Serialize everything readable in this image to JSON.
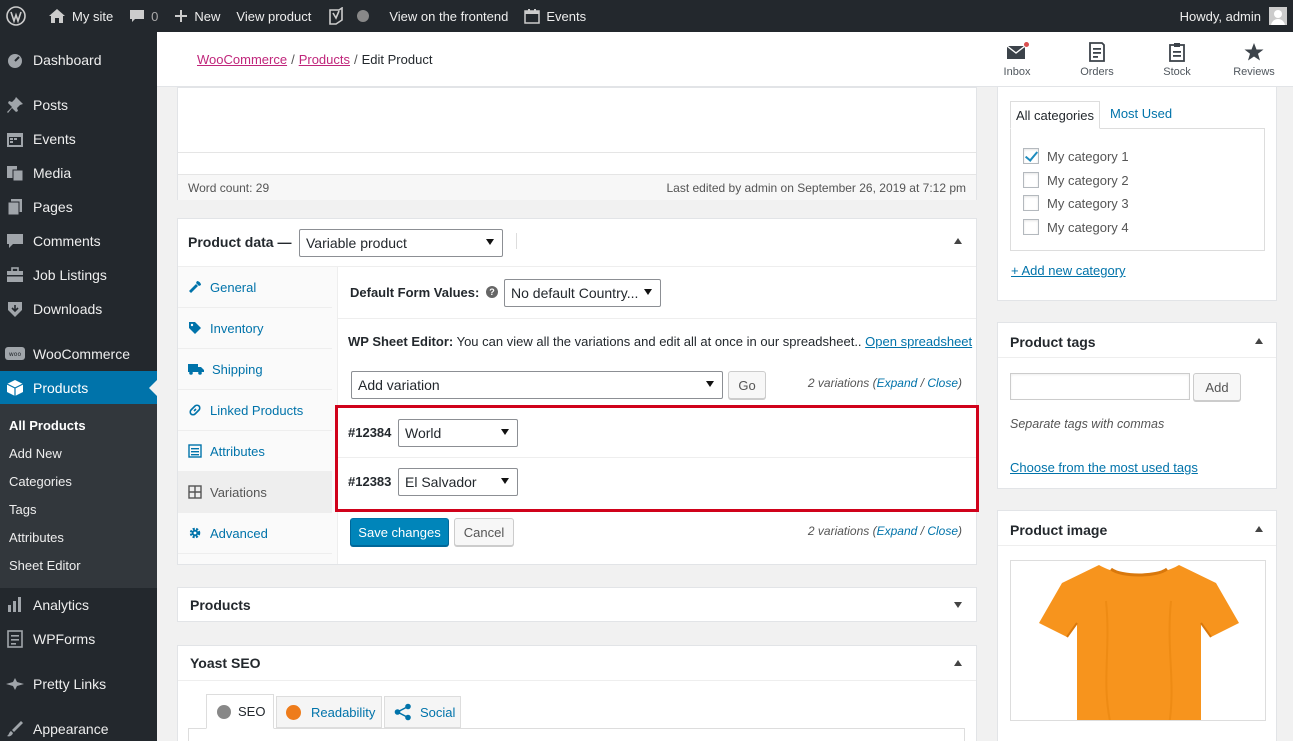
{
  "adminbar": {
    "site_name": "My site",
    "comments_count": "0",
    "new_label": "New",
    "view_product": "View product",
    "view_frontend": "View on the frontend",
    "events": "Events",
    "howdy": "Howdy, admin"
  },
  "sidebar": {
    "items": [
      {
        "label": "Dashboard",
        "icon": "dashboard-icon"
      },
      {
        "label": "Posts",
        "icon": "pin-icon"
      },
      {
        "label": "Events",
        "icon": "calendar-icon"
      },
      {
        "label": "Media",
        "icon": "media-icon"
      },
      {
        "label": "Pages",
        "icon": "pages-icon"
      },
      {
        "label": "Comments",
        "icon": "comment-icon"
      },
      {
        "label": "Job Listings",
        "icon": "briefcase-icon"
      },
      {
        "label": "Downloads",
        "icon": "download-icon"
      },
      {
        "label": "WooCommerce",
        "icon": "woo-icon"
      },
      {
        "label": "Products",
        "icon": "box-icon"
      },
      {
        "label": "Analytics",
        "icon": "bar-chart-icon"
      },
      {
        "label": "WPForms",
        "icon": "forms-icon"
      },
      {
        "label": "Pretty Links",
        "icon": "star-icon"
      },
      {
        "label": "Appearance",
        "icon": "brush-icon"
      }
    ],
    "submenu": [
      "All Products",
      "Add New",
      "Categories",
      "Tags",
      "Attributes",
      "Sheet Editor"
    ]
  },
  "header": {
    "crumb_1": "WooCommerce",
    "crumb_2": "Products",
    "crumb_3": "Edit Product",
    "sep": "/",
    "inbox": "Inbox",
    "orders": "Orders",
    "stock": "Stock",
    "reviews": "Reviews"
  },
  "editor": {
    "word_count": "Word count: 29",
    "last_edited": "Last edited by admin on September 26, 2019 at 7:12 pm"
  },
  "product_data": {
    "title": "Product data —",
    "type_value": "Variable product",
    "tabs": [
      "General",
      "Inventory",
      "Shipping",
      "Linked Products",
      "Attributes",
      "Variations",
      "Advanced"
    ],
    "default_form_values_label": "Default Form Values:",
    "default_country": "No default Country...",
    "sheet_editor_bold": "WP Sheet Editor:",
    "sheet_editor_text": " You can view all the variations and edit all at once in our spreadsheet..",
    "open_spreadsheet": "Open spreadsheet",
    "add_variation": "Add variation",
    "go": "Go",
    "variations_count": "2 variations (",
    "expand": "Expand",
    "slash": " / ",
    "close": "Close",
    "close_paren": ")",
    "variations": [
      {
        "id": "#12384",
        "value": "World"
      },
      {
        "id": "#12383",
        "value": "El Salvador"
      }
    ],
    "save_changes": "Save changes",
    "cancel": "Cancel"
  },
  "products_panel": {
    "title": "Products"
  },
  "yoast": {
    "title": "Yoast SEO",
    "tabs": [
      "SEO",
      "Readability",
      "Social"
    ]
  },
  "categories": {
    "tab_all": "All categories",
    "tab_most_used": "Most Used",
    "items": [
      {
        "label": "My category 1",
        "checked": true
      },
      {
        "label": "My category 2",
        "checked": false
      },
      {
        "label": "My category 3",
        "checked": false
      },
      {
        "label": "My category 4",
        "checked": false
      }
    ],
    "add_new": "+ Add new category"
  },
  "tags": {
    "title": "Product tags",
    "add": "Add",
    "hint": "Separate tags with commas",
    "choose": "Choose from the most used tags"
  },
  "product_image": {
    "title": "Product image",
    "shirt_color": "#f7941d"
  },
  "colors": {
    "highlight_border": "#d0021b",
    "accent": "#0073aa"
  }
}
